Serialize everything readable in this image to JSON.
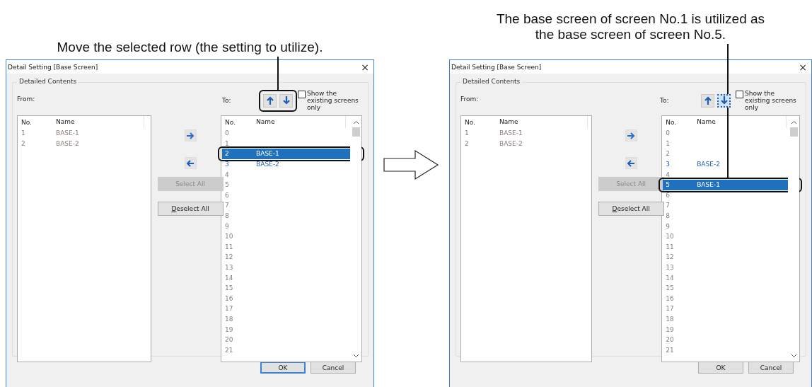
{
  "panels": [
    {
      "caption": "Move the selected row (the setting to utilize).",
      "dialog": {
        "title": "Detail Setting [Base Screen]",
        "close": "×",
        "group_label": "Detailed Contents",
        "from_label": "From:",
        "to_label": "To:",
        "from_list": {
          "columns": [
            "No.",
            "Name"
          ],
          "rows": [
            {
              "no": "1",
              "name": "BASE-1"
            },
            {
              "no": "2",
              "name": "BASE-2"
            }
          ]
        },
        "select_all": {
          "label": "Select All",
          "disabled": true
        },
        "deselect_all": {
          "label": "Deselect All",
          "disabled": false
        },
        "move_buttons": {
          "callout": true,
          "up_focused": false,
          "down_focused": false
        },
        "checkbox": {
          "label": "Show the existing screens only",
          "checked": false
        },
        "to_list": {
          "columns": [
            "No.",
            "Name"
          ],
          "rows": [
            {
              "no": "0",
              "selected": false,
              "existing": false,
              "callout": false
            },
            {
              "no": "1",
              "selected": false,
              "existing": false,
              "callout": false
            },
            {
              "no": "2",
              "name": "BASE-1",
              "selected": true,
              "existing": true,
              "callout": true
            },
            {
              "no": "3",
              "name": "BASE-2",
              "selected": false,
              "existing": true,
              "callout": false
            },
            {
              "no": "4",
              "selected": false,
              "existing": false,
              "callout": false
            },
            {
              "no": "5",
              "selected": false,
              "existing": false,
              "callout": false
            },
            {
              "no": "6",
              "selected": false,
              "existing": false,
              "callout": false
            },
            {
              "no": "7",
              "selected": false,
              "existing": false,
              "callout": false
            },
            {
              "no": "8",
              "selected": false,
              "existing": false,
              "callout": false
            },
            {
              "no": "9",
              "selected": false,
              "existing": false,
              "callout": false
            },
            {
              "no": "10",
              "selected": false,
              "existing": false,
              "callout": false
            },
            {
              "no": "11",
              "selected": false,
              "existing": false,
              "callout": false
            },
            {
              "no": "12",
              "selected": false,
              "existing": false,
              "callout": false
            },
            {
              "no": "13",
              "selected": false,
              "existing": false,
              "callout": false
            },
            {
              "no": "14",
              "selected": false,
              "existing": false,
              "callout": false
            },
            {
              "no": "15",
              "selected": false,
              "existing": false,
              "callout": false
            },
            {
              "no": "16",
              "selected": false,
              "existing": false,
              "callout": false
            },
            {
              "no": "17",
              "selected": false,
              "existing": false,
              "callout": false
            },
            {
              "no": "18",
              "selected": false,
              "existing": false,
              "callout": false
            },
            {
              "no": "19",
              "selected": false,
              "existing": false,
              "callout": false
            },
            {
              "no": "20",
              "selected": false,
              "existing": false,
              "callout": false
            },
            {
              "no": "21",
              "selected": false,
              "existing": false,
              "callout": false
            }
          ]
        },
        "buttons": [
          {
            "label": "OK",
            "default": true
          },
          {
            "label": "Cancel",
            "default": false
          }
        ]
      }
    },
    {
      "caption": "The base screen of screen No.1 is utilized as the base screen of screen No.5.",
      "dialog": {
        "title": "Detail Setting [Base Screen]",
        "close": "×",
        "group_label": "Detailed Contents",
        "from_label": "From:",
        "to_label": "To:",
        "from_list": {
          "columns": [
            "No.",
            "Name"
          ],
          "rows": [
            {
              "no": "1",
              "name": "BASE-1"
            },
            {
              "no": "2",
              "name": "BASE-2"
            }
          ]
        },
        "select_all": {
          "label": "Select All",
          "disabled": true
        },
        "deselect_all": {
          "label": "Deselect All",
          "disabled": false
        },
        "move_buttons": {
          "callout": false,
          "up_focused": false,
          "down_focused": true
        },
        "checkbox": {
          "label": "Show the existing screens only",
          "checked": false
        },
        "to_list": {
          "columns": [
            "No.",
            "Name"
          ],
          "rows": [
            {
              "no": "0",
              "selected": false,
              "existing": false,
              "callout": false
            },
            {
              "no": "1",
              "selected": false,
              "existing": false,
              "callout": false
            },
            {
              "no": "2",
              "selected": false,
              "existing": false,
              "callout": false
            },
            {
              "no": "3",
              "name": "BASE-2",
              "selected": false,
              "existing": true,
              "callout": false
            },
            {
              "no": "4",
              "selected": false,
              "existing": false,
              "callout": false
            },
            {
              "no": "5",
              "name": "BASE-1",
              "selected": true,
              "existing": true,
              "callout": true
            },
            {
              "no": "6",
              "selected": false,
              "existing": false,
              "callout": false
            },
            {
              "no": "7",
              "selected": false,
              "existing": false,
              "callout": false
            },
            {
              "no": "8",
              "selected": false,
              "existing": false,
              "callout": false
            },
            {
              "no": "9",
              "selected": false,
              "existing": false,
              "callout": false
            },
            {
              "no": "10",
              "selected": false,
              "existing": false,
              "callout": false
            },
            {
              "no": "11",
              "selected": false,
              "existing": false,
              "callout": false
            },
            {
              "no": "12",
              "selected": false,
              "existing": false,
              "callout": false
            },
            {
              "no": "13",
              "selected": false,
              "existing": false,
              "callout": false
            },
            {
              "no": "14",
              "selected": false,
              "existing": false,
              "callout": false
            },
            {
              "no": "15",
              "selected": false,
              "existing": false,
              "callout": false
            },
            {
              "no": "16",
              "selected": false,
              "existing": false,
              "callout": false
            },
            {
              "no": "17",
              "selected": false,
              "existing": false,
              "callout": false
            },
            {
              "no": "18",
              "selected": false,
              "existing": false,
              "callout": false
            },
            {
              "no": "19",
              "selected": false,
              "existing": false,
              "callout": false
            },
            {
              "no": "20",
              "selected": false,
              "existing": false,
              "callout": false
            },
            {
              "no": "21",
              "selected": false,
              "existing": false,
              "callout": false
            }
          ]
        },
        "buttons": [
          {
            "label": "OK",
            "default": false
          },
          {
            "label": "Cancel",
            "default": false
          }
        ]
      }
    }
  ]
}
